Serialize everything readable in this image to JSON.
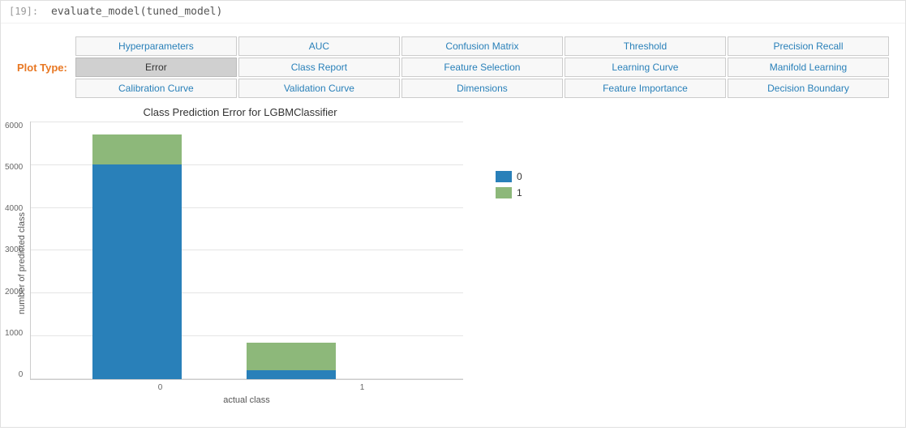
{
  "cell": {
    "label": "[19]:",
    "code": "evaluate_model(tuned_model)"
  },
  "plot_type": {
    "label": "Plot Type:",
    "buttons": [
      {
        "id": "hyperparameters",
        "label": "Hyperparameters",
        "active": false
      },
      {
        "id": "auc",
        "label": "AUC",
        "active": false
      },
      {
        "id": "confusion-matrix",
        "label": "Confusion Matrix",
        "active": false
      },
      {
        "id": "threshold",
        "label": "Threshold",
        "active": false
      },
      {
        "id": "precision-recall",
        "label": "Precision Recall",
        "active": false
      },
      {
        "id": "error",
        "label": "Error",
        "active": true
      },
      {
        "id": "class-report",
        "label": "Class Report",
        "active": false
      },
      {
        "id": "feature-selection",
        "label": "Feature Selection",
        "active": false
      },
      {
        "id": "learning-curve",
        "label": "Learning Curve",
        "active": false
      },
      {
        "id": "manifold-learning",
        "label": "Manifold Learning",
        "active": false
      },
      {
        "id": "calibration-curve",
        "label": "Calibration Curve",
        "active": false
      },
      {
        "id": "validation-curve",
        "label": "Validation Curve",
        "active": false
      },
      {
        "id": "dimensions",
        "label": "Dimensions",
        "active": false
      },
      {
        "id": "feature-importance",
        "label": "Feature Importance",
        "active": false
      },
      {
        "id": "decision-boundary",
        "label": "Decision Boundary",
        "active": false
      }
    ]
  },
  "chart": {
    "title": "Class Prediction Error for LGBMClassifier",
    "y_axis_label": "number of predicted class",
    "x_axis_label": "actual class",
    "y_ticks": [
      "6000",
      "5000",
      "4000",
      "3000",
      "2000",
      "1000",
      "0"
    ],
    "x_ticks": [
      "0",
      "1"
    ],
    "bars": [
      {
        "label": "0",
        "segments": [
          {
            "class": 0,
            "value": 5300,
            "color": "#2980b9"
          },
          {
            "class": 1,
            "value": 750,
            "color": "#8db87a"
          }
        ]
      },
      {
        "label": "1",
        "segments": [
          {
            "class": 0,
            "value": 220,
            "color": "#2980b9"
          },
          {
            "class": 1,
            "value": 680,
            "color": "#8db87a"
          }
        ]
      }
    ],
    "legend": [
      {
        "label": "0",
        "color": "#2980b9"
      },
      {
        "label": "1",
        "color": "#8db87a"
      }
    ]
  },
  "colors": {
    "active_btn_bg": "#d0d0d0",
    "btn_text": "#2980b9",
    "plot_label": "#e87722"
  }
}
